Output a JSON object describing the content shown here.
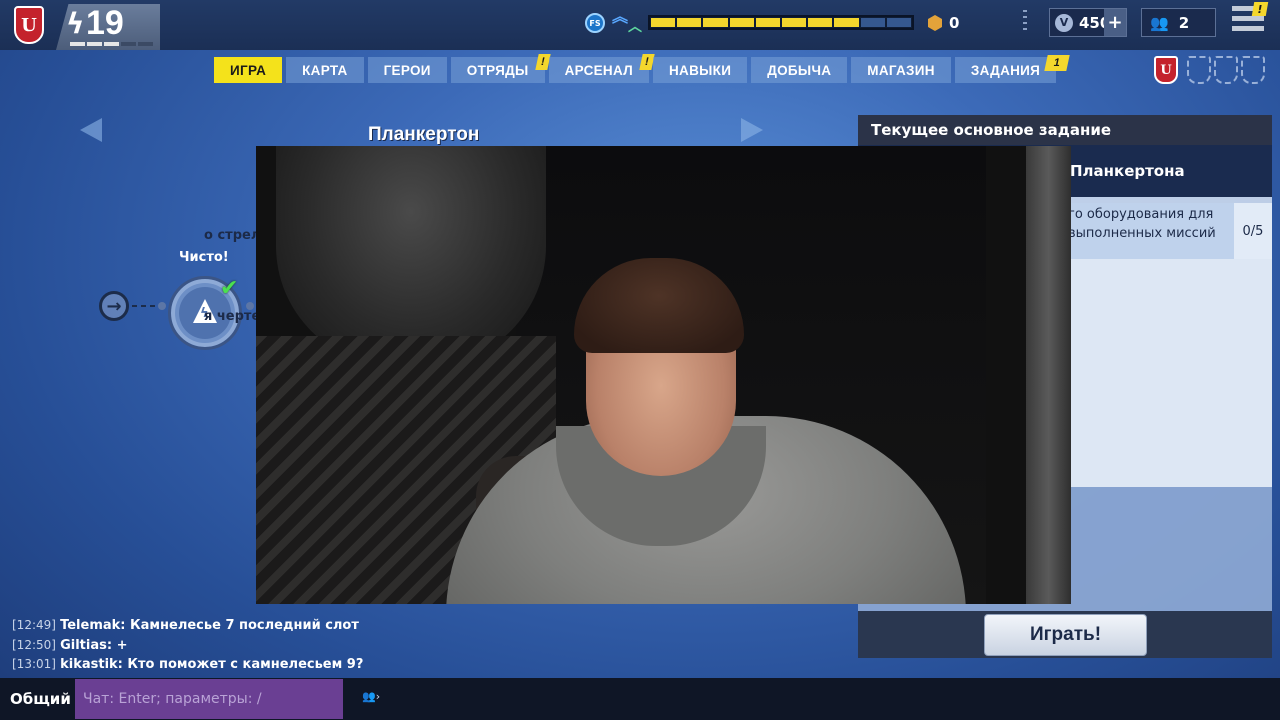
{
  "topbar": {
    "level": "19",
    "fs_icon": "FS",
    "gold": "0",
    "vbucks": "450",
    "vbucks_plus": "+",
    "friends": "2",
    "menu_badge": "!"
  },
  "nav": {
    "tabs": [
      {
        "label": "ИГРА",
        "active": true
      },
      {
        "label": "КАРТА"
      },
      {
        "label": "ГЕРОИ"
      },
      {
        "label": "ОТРЯДЫ",
        "badge": "!"
      },
      {
        "label": "АРСЕНАЛ",
        "badge": "!"
      },
      {
        "label": "НАВЫКИ"
      },
      {
        "label": "ДОБЫЧА"
      },
      {
        "label": "МАГАЗИН"
      },
      {
        "label": "ЗАДАНИЯ",
        "badge": "1"
      }
    ]
  },
  "campaign": {
    "zone_title": "Планкертон",
    "node_status": "Чисто!"
  },
  "quest": {
    "header": "Текущее основное задание",
    "title": "Планкертона",
    "objective": "го оборудования для выполненных миссий",
    "count": "0/5",
    "reward1": "о стрелкового оружия",
    "reward2": "я чертежей",
    "play_label": "Играть!"
  },
  "chat": {
    "messages": [
      {
        "time": "[12:49]",
        "text": "Telemak: Камнелесье 7 последний слот"
      },
      {
        "time": "[12:50]",
        "text": "Giltias: +"
      },
      {
        "time": "[13:01]",
        "text": "kikastik: Кто поможет с камнелесьем 9?"
      }
    ],
    "channel": "Общий",
    "placeholder": "Чат: Enter; параметры: /"
  },
  "power_bar": {
    "fill": 0.8
  },
  "colors": {
    "accent": "#f4e21b",
    "brand": "#c4222c",
    "chat_input": "#6a3f93"
  }
}
